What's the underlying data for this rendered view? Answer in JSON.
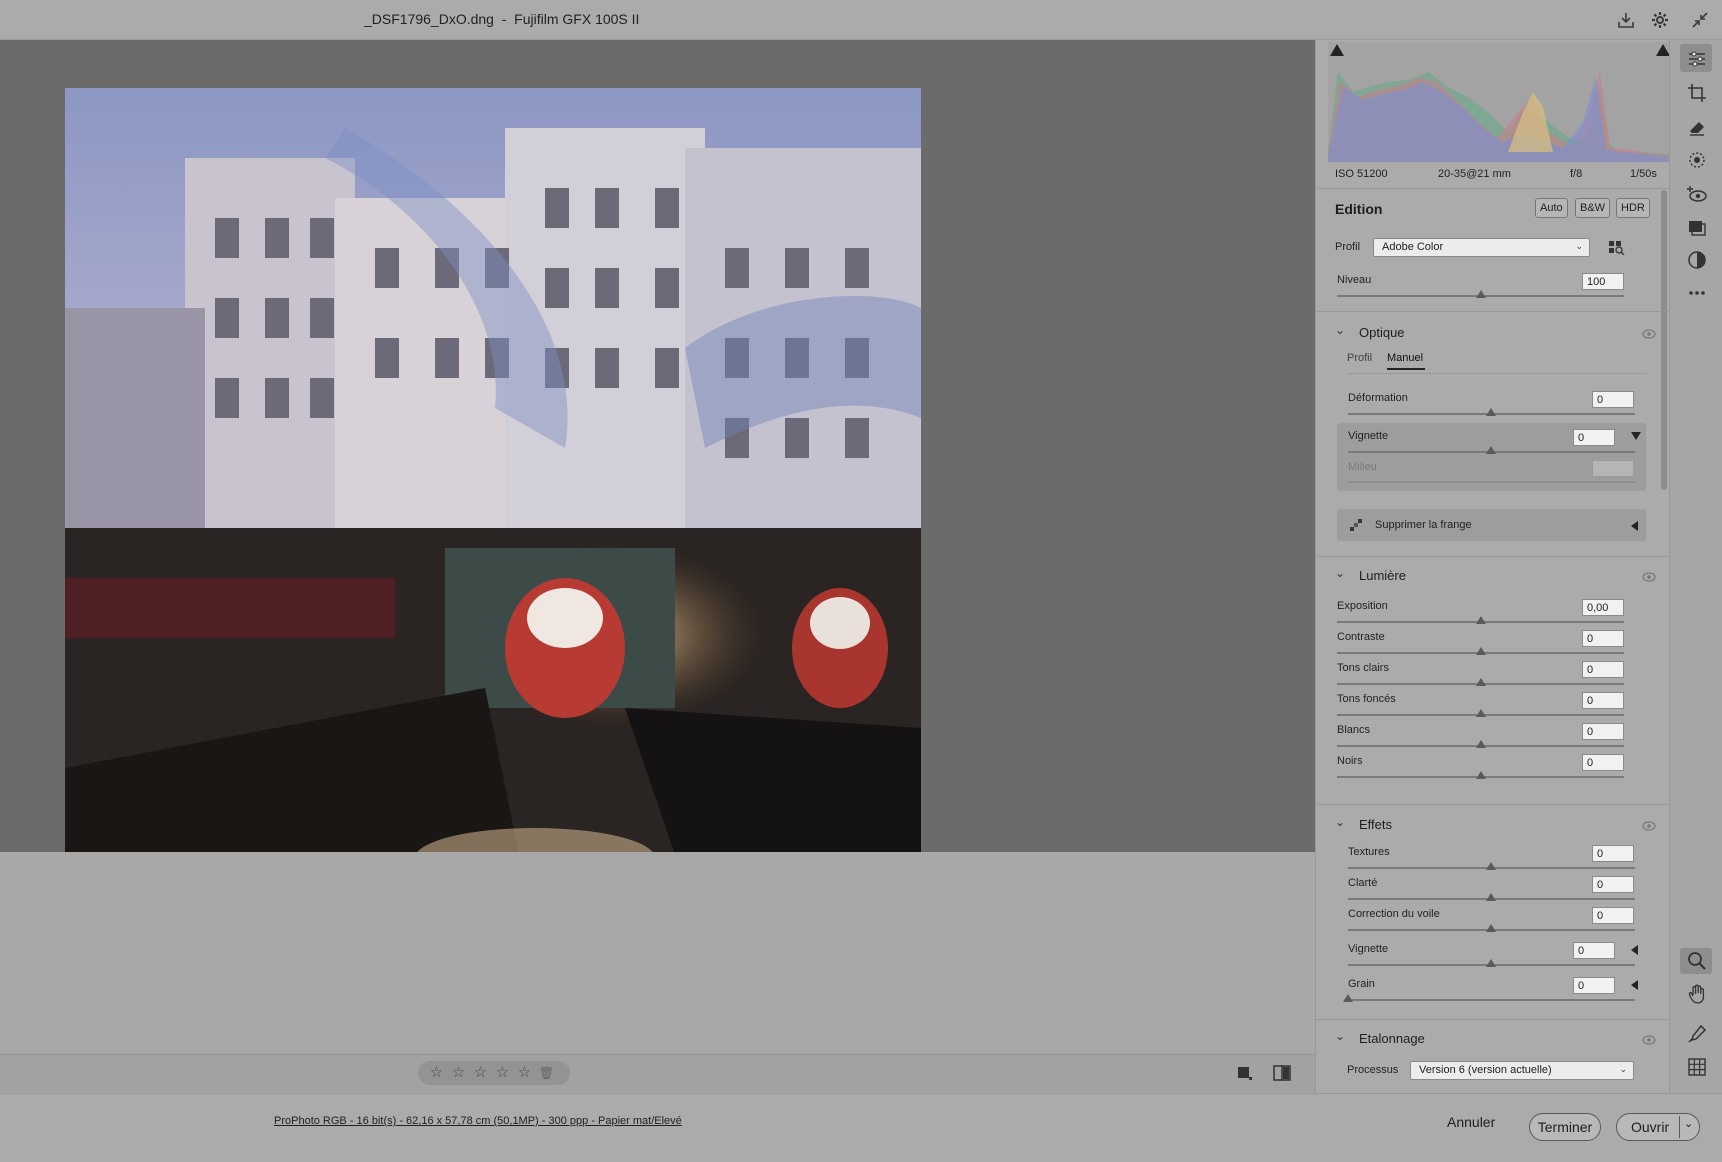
{
  "titlebar": {
    "title": "_DSF1796_DxO.dng  -  Fujifilm GFX 100S II"
  },
  "exif": {
    "iso": "ISO 51200",
    "lens": "20-35@21 mm",
    "aperture": "f/8",
    "shutter": "1/50s"
  },
  "edition": {
    "title": "Edition",
    "buttons": [
      "Auto",
      "B&W",
      "HDR"
    ],
    "profile_label": "Profil",
    "profile_value": "Adobe Color",
    "level_label": "Niveau",
    "level_value": "100"
  },
  "optique": {
    "title": "Optique",
    "tabs": [
      "Profil",
      "Manuel"
    ],
    "deformation_label": "Déformation",
    "deformation_value": "0",
    "vignette_label": "Vignette",
    "vignette_value": "0",
    "milieu_label": "Milieu",
    "frange_label": "Supprimer la frange"
  },
  "lumiere": {
    "title": "Lumière",
    "sliders": [
      {
        "label": "Exposition",
        "value": "0,00"
      },
      {
        "label": "Contraste",
        "value": "0"
      },
      {
        "label": "Tons clairs",
        "value": "0"
      },
      {
        "label": "Tons foncés",
        "value": "0"
      },
      {
        "label": "Blancs",
        "value": "0"
      },
      {
        "label": "Noirs",
        "value": "0"
      }
    ]
  },
  "effets": {
    "title": "Effets",
    "sliders": [
      {
        "label": "Textures",
        "value": "0"
      },
      {
        "label": "Clarté",
        "value": "0"
      },
      {
        "label": "Correction du voile",
        "value": "0"
      },
      {
        "label": "Vignette",
        "value": "0"
      },
      {
        "label": "Grain",
        "value": "0"
      }
    ]
  },
  "etalonnage": {
    "title": "Etalonnage",
    "process_label": "Processus",
    "process_value": "Version 6 (version actuelle)"
  },
  "footer": {
    "info": "ProPhoto RGB - 16 bit(s) - 62,16 x 57,78 cm  (50,1MP) - 300 ppp - Papier mat/Elevé",
    "cancel": "Annuler",
    "done": "Terminer",
    "open": "Ouvrir"
  },
  "rating": {
    "stars": [
      "☆",
      "☆",
      "☆",
      "☆",
      "☆"
    ],
    "trash": "🗑"
  },
  "colors": {
    "panel_bg": "#ababab",
    "canvas_bg": "#6b6b6b"
  }
}
